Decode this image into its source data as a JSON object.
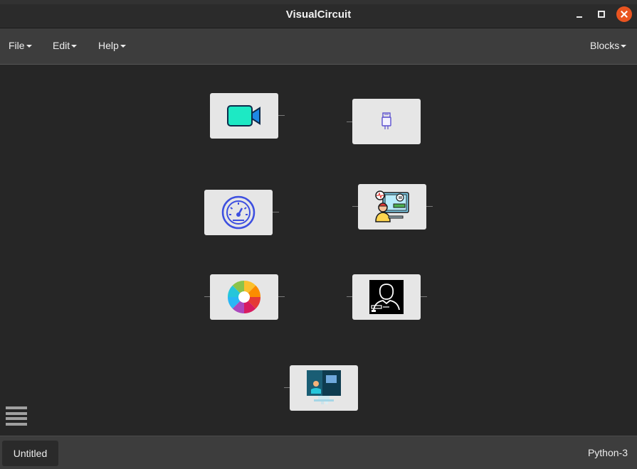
{
  "window": {
    "title": "VisualCircuit"
  },
  "menubar": {
    "file_label": "File",
    "edit_label": "Edit",
    "help_label": "Help",
    "blocks_label": "Blocks"
  },
  "blocks": [
    {
      "icon": "camera-icon"
    },
    {
      "icon": "usb-drive-icon"
    },
    {
      "icon": "speedometer-icon"
    },
    {
      "icon": "data-analyst-icon"
    },
    {
      "icon": "color-wheel-icon"
    },
    {
      "icon": "face-detection-icon"
    },
    {
      "icon": "screen-display-icon"
    }
  ],
  "statusbar": {
    "tab_label": "Untitled",
    "kernel_label": "Python-3"
  },
  "colors": {
    "accent_close": "#e95420",
    "canvas_bg": "#262626",
    "block_bg": "#e6e6e6"
  }
}
